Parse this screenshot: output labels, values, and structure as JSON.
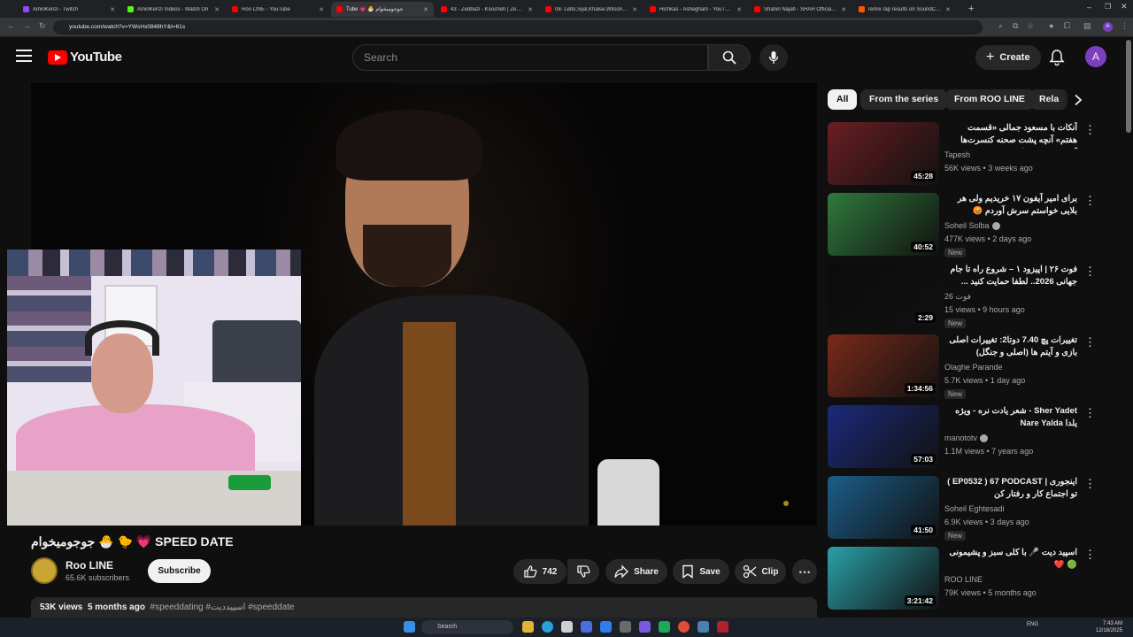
{
  "browser": {
    "tabs": [
      {
        "label": "AminKenzi - Twitch",
        "color": "#9146ff"
      },
      {
        "label": "AminKenzi Videos - Watch On",
        "color": "#53fc18"
      },
      {
        "label": "Roo LINE - YouTube",
        "color": "#ff0000"
      },
      {
        "label": "Tube 💗 🐣 جوجومیخوام",
        "color": "#ff0000",
        "active": true
      },
      {
        "label": "43 - Zedbazi - Koocheh | Zedbazi",
        "color": "#ff0000"
      },
      {
        "label": "08- Lelto,Sijal,Khalse,Wilson,Sa",
        "color": "#ff0000"
      },
      {
        "label": "Hichkas - Ashegham - YouTube",
        "color": "#ff0000"
      },
      {
        "label": "Shahin Najafi - SHAH Official M",
        "color": "#ff0000"
      },
      {
        "label": "remix rap results on SoundClou",
        "color": "#ff5500"
      }
    ],
    "url": "youtube.com/watch?v=YWsHx0848hY&t=61s"
  },
  "header": {
    "logo_text": "YouTube",
    "search_placeholder": "Search",
    "create_label": "Create",
    "avatar_letter": "A"
  },
  "chips": [
    "All",
    "From the series",
    "From ROO LINE",
    "Rela"
  ],
  "video": {
    "title": "جوجومیخوام 🐣 🐤 💗 SPEED DATE",
    "channel": "Roo LINE",
    "subscribers": "65.6K subscribers",
    "subscribe_label": "Subscribe",
    "likes": "742",
    "share_label": "Share",
    "save_label": "Save",
    "clip_label": "Clip",
    "views": "53K views",
    "age": "5 months ago",
    "tags": "#speeddating #اسپیددیت #speeddate"
  },
  "related": [
    {
      "title": "آنکات با مسعود جمالی «قسمت هفتم» آنچه پشت صحنه کنسرت‌ها گذشت وحرف‌هایی ...",
      "channel": "Tapesh",
      "views": "56K views",
      "age": "3 weeks ago",
      "duration": "45:28",
      "new": "",
      "verified": false,
      "thumb": "#6a1e22"
    },
    {
      "title": "برای امیر آیفون ۱۷ خریدیم ولی هر بلایی خواستم سرش آوردم 😡",
      "channel": "Soheil Solba",
      "views": "477K views",
      "age": "2 days ago",
      "duration": "40:52",
      "new": "New",
      "verified": true,
      "thumb": "#2f7a3a"
    },
    {
      "title": "فوت ۲۶ | اپیزود ۱ – شروع راه تا جام جهانی 2026.. لطفا حمایت کنید ...",
      "channel": "فوت 26",
      "views": "15 views",
      "age": "9 hours ago",
      "duration": "2:29",
      "new": "New",
      "verified": false,
      "thumb": "#0b0b0b"
    },
    {
      "title": "تغییرات پچ 7.40 دوتا2: تغییرات اصلی بازی و آیتم ها (اصلی و جنگل)",
      "channel": "Olaghe Parande",
      "views": "5.7K views",
      "age": "1 day ago",
      "duration": "1:34:56",
      "new": "New",
      "verified": false,
      "thumb": "#7a2a1a"
    },
    {
      "title": "Sher Yadet - شعر یادت نره - ویژه یلدا Nare Yalda",
      "channel": "manototv",
      "views": "1.1M views",
      "age": "7 years ago",
      "duration": "57:03",
      "new": "",
      "verified": true,
      "thumb": "#1c2a7a"
    },
    {
      "title": "اینجوری | EP0532 ) 67 PODCAST ) تو اجتماع کار و رفتار کن",
      "channel": "Soheil Eghtesadi",
      "views": "6.9K views",
      "age": "3 days ago",
      "duration": "41:50",
      "new": "New",
      "verified": false,
      "thumb": "#1b5e8a"
    },
    {
      "title": "اسپید دیت 🎤 با کلی سبز و پشیمونی 🟢 ❤️",
      "channel": "ROO LINE",
      "views": "79K views",
      "age": "5 months ago",
      "duration": "3:21:42",
      "new": "",
      "verified": false,
      "thumb": "#2aa0a8"
    }
  ],
  "taskbar": {
    "search_label": "Search",
    "lang": "ENG",
    "time": "7:43 AM",
    "date": "12/18/2025"
  }
}
